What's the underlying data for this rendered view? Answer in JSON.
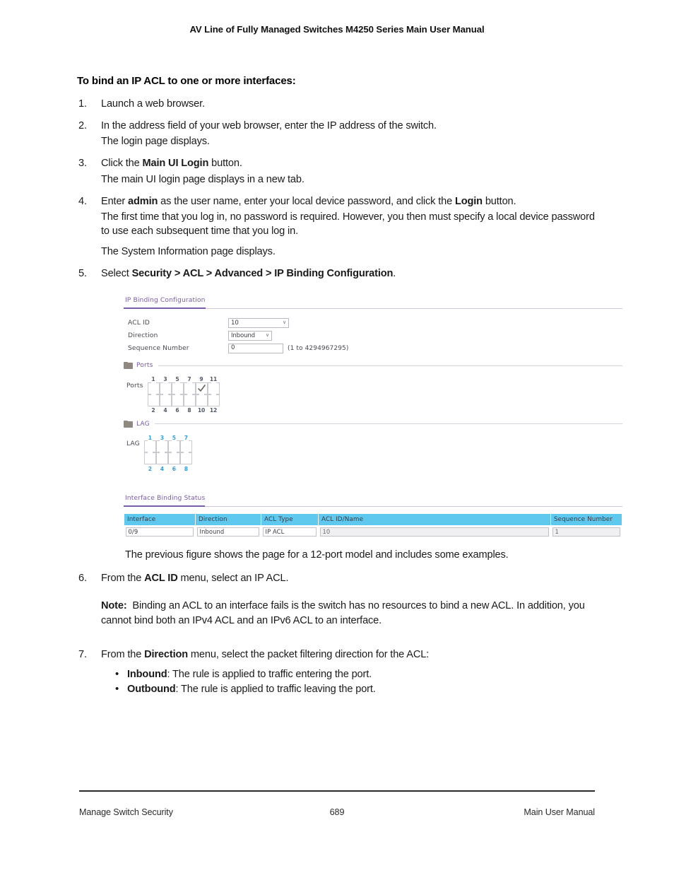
{
  "header": {
    "title": "AV Line of Fully Managed Switches M4250 Series Main User Manual"
  },
  "section": {
    "title": "To bind an IP ACL to one or more interfaces:"
  },
  "steps": [
    {
      "num": "1.",
      "text": "Launch a web browser."
    },
    {
      "num": "2.",
      "text": "In the address field of your web browser, enter the IP address of the switch.",
      "sub": "The login page displays."
    },
    {
      "num": "3.",
      "text_pre": "Click the ",
      "text_bold": "Main UI Login",
      "text_post": " button.",
      "sub": "The main UI login page displays in a new tab."
    },
    {
      "num": "4.",
      "text_pre": "Enter ",
      "text_bold": "admin",
      "text_mid": " as the user name, enter your local device password, and click the ",
      "text_bold2": "Login",
      "text_post": " button.",
      "sub": "The first time that you log in, no password is required. However, you then must specify a local device password to use each subsequent time that you log in.",
      "sub2": "The System Information page displays."
    },
    {
      "num": "5.",
      "text_pre": "Select ",
      "text_bold": "Security > ACL > Advanced > IP Binding Configuration",
      "text_post": "."
    },
    {
      "num": "6.",
      "text_pre": "From the ",
      "text_bold": "ACL ID",
      "text_post": " menu, select an IP ACL."
    },
    {
      "num": "7.",
      "text_pre": "From the ",
      "text_bold": "Direction",
      "text_post": " menu, select the packet filtering direction for the ACL:"
    }
  ],
  "figure_caption": "The previous figure shows the page for a 12-port model and includes some examples.",
  "note": {
    "label": "Note:",
    "text": "Binding an ACL to an interface fails is the switch has no resources to bind a new ACL. In addition, you cannot bind both an IPv4 ACL and an IPv6 ACL to an interface."
  },
  "bullets": [
    {
      "term": "Inbound",
      "desc": ": The rule is applied to traffic entering the port."
    },
    {
      "term": "Outbound",
      "desc": ": The rule is applied to traffic leaving the port."
    }
  ],
  "figure": {
    "tab_title": "IP Binding Configuration",
    "form": {
      "acl_id": {
        "label": "ACL ID",
        "value": "10",
        "caret": "∨"
      },
      "direction": {
        "label": "Direction",
        "value": "Inbound",
        "caret": "∨"
      },
      "sequence_number": {
        "label": "Sequence Number",
        "value": "0",
        "hint": "(1 to 4294967295)"
      }
    },
    "ports_group": {
      "title": "Ports",
      "row_label": "Ports",
      "top_numbers": [
        "1",
        "3",
        "5",
        "7",
        "9",
        "11"
      ],
      "bottom_numbers": [
        "2",
        "4",
        "6",
        "8",
        "10",
        "12"
      ],
      "selected": [
        "9"
      ]
    },
    "lag_group": {
      "title": "LAG",
      "row_label": "LAG",
      "top_numbers": [
        "1",
        "3",
        "5",
        "7"
      ],
      "bottom_numbers": [
        "2",
        "4",
        "6",
        "8"
      ],
      "selected": []
    },
    "status": {
      "tab_title": "Interface Binding Status",
      "columns": [
        "Interface",
        "Direction",
        "ACL Type",
        "ACL ID/Name",
        "Sequence Number"
      ],
      "rows": [
        {
          "interface": "0/9",
          "direction": "Inbound",
          "acl_type": "IP ACL",
          "acl_id_name": "10",
          "sequence_number": "1"
        }
      ]
    },
    "colors": {
      "tab_purple": "#7a5ca8",
      "table_header": "#5ec8ef",
      "jack_gray": "#8f8881",
      "lag_number_blue": "#2f9fe0"
    }
  },
  "footer": {
    "left": "Manage Switch Security",
    "page": "689",
    "right": "Main User Manual"
  }
}
